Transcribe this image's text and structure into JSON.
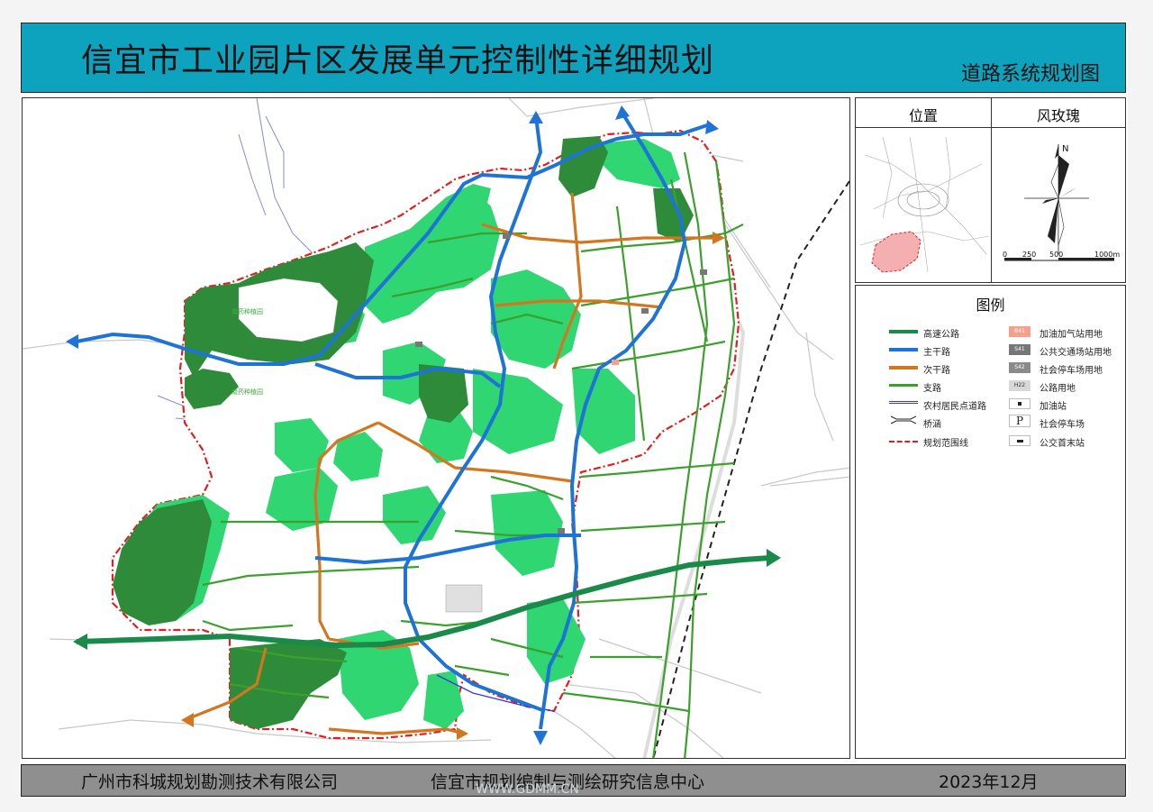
{
  "header": {
    "title": "信宜市工业园片区发展单元控制性详细规划",
    "subtitle": "道路系统规划图"
  },
  "location_panel": {
    "title": "位置"
  },
  "windrose_panel": {
    "title": "风玫瑰",
    "north": "N",
    "scale_labels": [
      "0",
      "250",
      "500",
      "1000m"
    ]
  },
  "legend": {
    "title": "图例",
    "left_items": [
      {
        "label": "高速公路",
        "color": "#1a8a4a"
      },
      {
        "label": "主干路",
        "color": "#1e73d6"
      },
      {
        "label": "次干路",
        "color": "#d4761f"
      },
      {
        "label": "支路",
        "color": "#3ca02c"
      },
      {
        "label": "农村居民点道路",
        "color": "#3a3ad0"
      },
      {
        "label": "桥涵",
        "color": "#222222"
      },
      {
        "label": "规划范围线",
        "color": "#e02020"
      }
    ],
    "right_items": [
      {
        "code": "B41",
        "label": "加油加气站用地",
        "color": "#f4a08a"
      },
      {
        "code": "S41",
        "label": "公共交通场站用地",
        "color": "#777777"
      },
      {
        "code": "S42",
        "label": "社会停车场用地",
        "color": "#8a8a8a"
      },
      {
        "code": "H22",
        "label": "公路用地",
        "color": "#d8d8d8"
      },
      {
        "code": "",
        "label": "加油站",
        "color": "#222222"
      },
      {
        "code": "P",
        "label": "社会停车场",
        "color": "#222222"
      },
      {
        "code": "",
        "label": "公交首末站",
        "color": "#222222"
      }
    ]
  },
  "map_labels": {
    "park_1": "南药种植园",
    "park_2": "南药种植园"
  },
  "footer": {
    "company": "广州市科城规划勘测技术有限公司",
    "center": "信宜市规划编制与测绘研究信息中心",
    "date": "2023年12月"
  },
  "watermark": "WWW.GDMM.CN",
  "colors": {
    "header_bg": "#0da3bf",
    "footer_bg": "#8f8f8f",
    "dark_green": "#2e8b3a",
    "light_green": "#2fd672"
  }
}
